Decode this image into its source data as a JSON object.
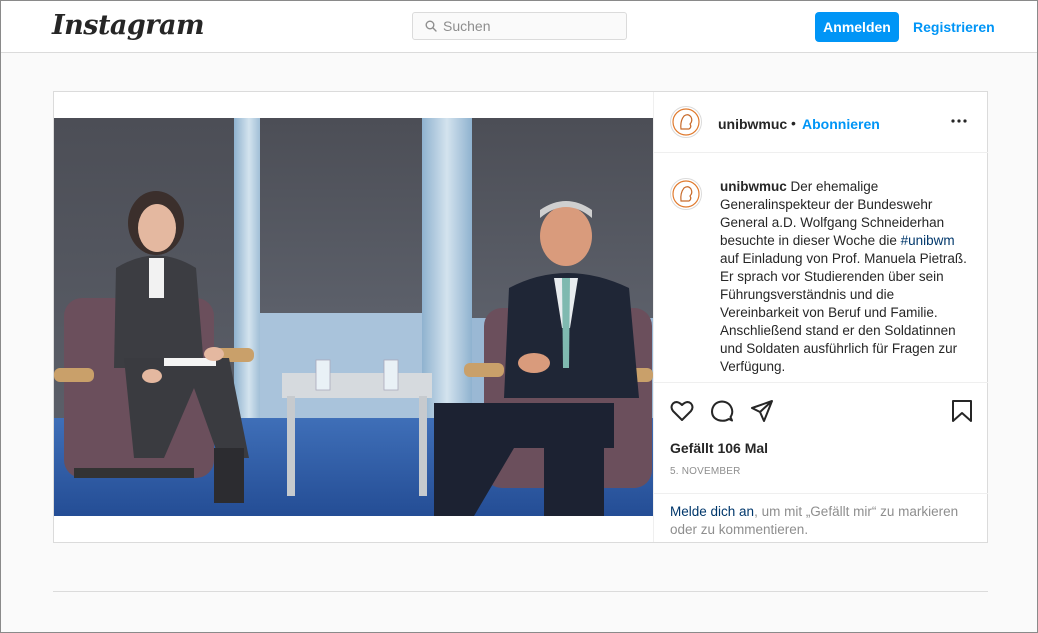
{
  "nav": {
    "logo": "Instagram",
    "search_placeholder": "Suchen",
    "login_label": "Anmelden",
    "register_label": "Registrieren"
  },
  "post": {
    "username": "unibwmuc",
    "separator": "•",
    "follow_label": "Abonnieren",
    "caption": {
      "username": "unibwmuc",
      "text_before": "Der ehemalige Generalinspekteur der Bundeswehr General a.D. Wolfgang Schneiderhan besuchte in dieser Woche die ",
      "hashtag": "#unibwm",
      "text_after": " auf Einladung von Prof. Manuela Pietraß. Er sprach vor Studierenden über sein Führungsverständnis und die Vereinbarkeit von Beruf und Familie. Anschließend stand er den Soldatinnen und Soldaten ausführlich für Fragen zur Verfügung."
    },
    "likes": "Gefällt 106 Mal",
    "date": "5. NOVEMBER",
    "login_prompt": {
      "link": "Melde dich an",
      "text": ", um mit „Gefällt mir“ zu markieren oder zu kommentieren."
    }
  },
  "icons": {
    "search": "search-icon",
    "more": "more-options-icon",
    "like": "heart-icon",
    "comment": "comment-icon",
    "share": "share-icon",
    "save": "bookmark-icon",
    "avatar": "university-logo"
  },
  "colors": {
    "accent": "#0095f6",
    "link_dark": "#00376b",
    "text": "#262626",
    "muted": "#8e8e8e",
    "border": "#dbdbdb",
    "background": "#fafafa"
  }
}
